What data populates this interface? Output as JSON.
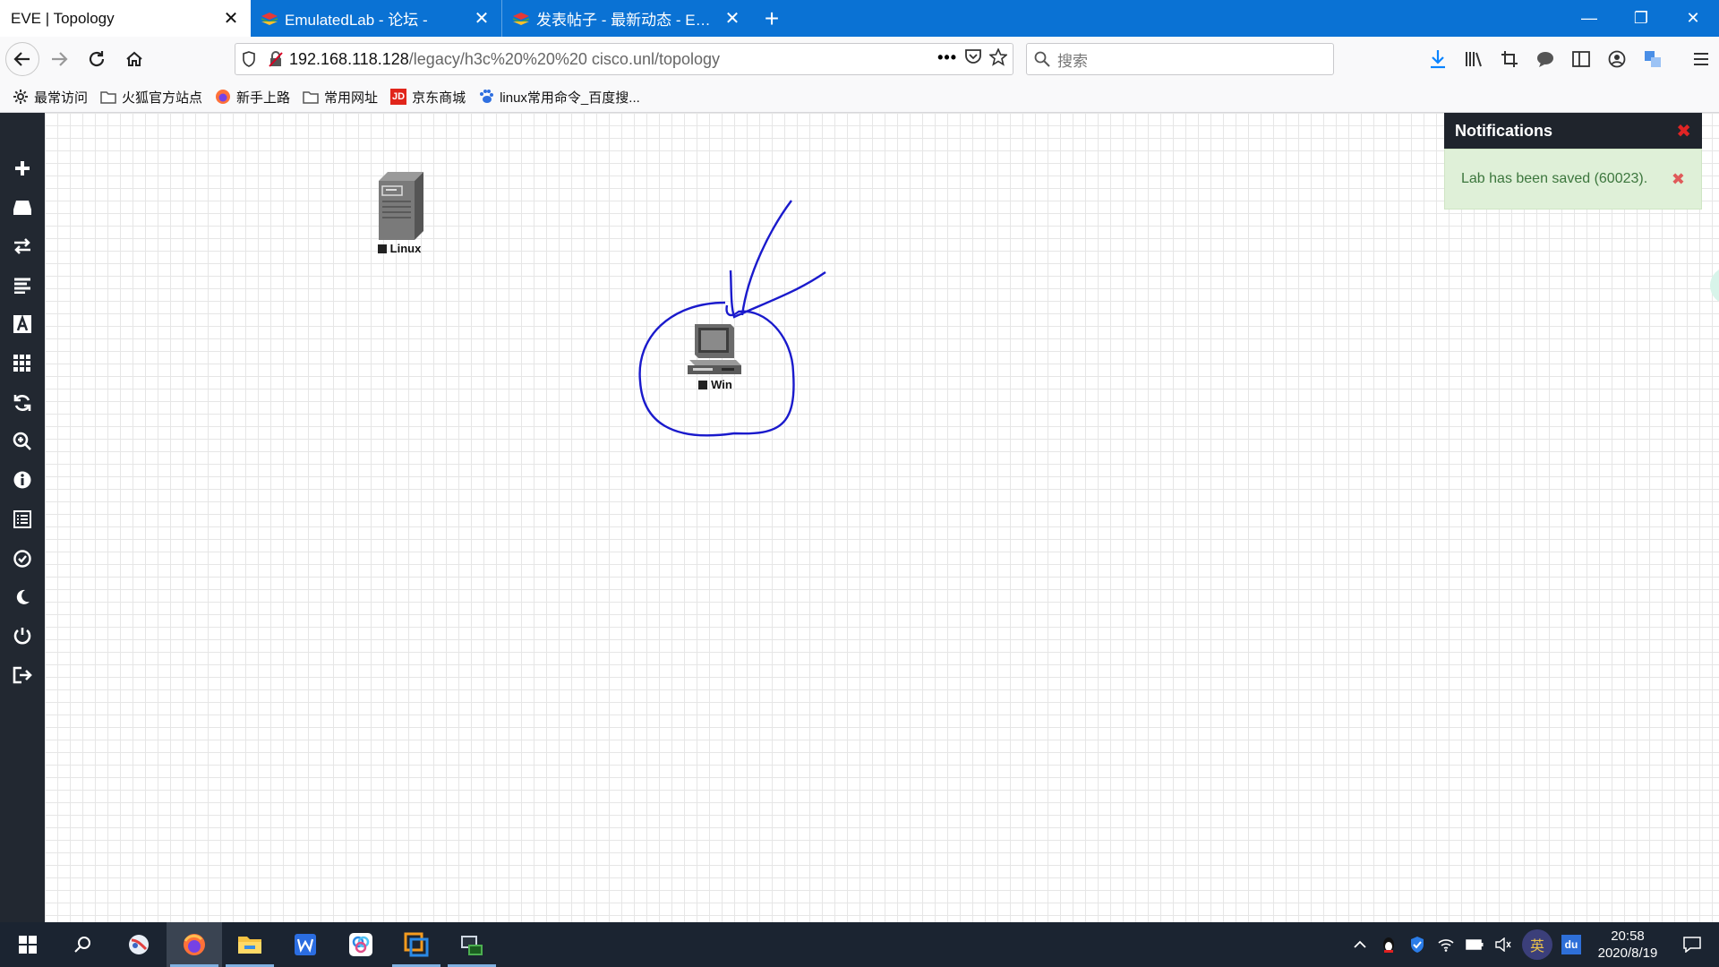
{
  "tabs": [
    {
      "label": "EVE | Topology",
      "active": true
    },
    {
      "label": "EmulatedLab - 论坛 -",
      "active": false
    },
    {
      "label": "发表帖子 - 最新动态 - Emulat",
      "active": false
    }
  ],
  "address": {
    "host": "192.168.118.128",
    "path": "/legacy/h3c%20%20%20 cisco.unl/topology"
  },
  "search": {
    "placeholder": "搜索"
  },
  "bookmarks": [
    {
      "label": "最常访问",
      "icon": "gear-icon"
    },
    {
      "label": "火狐官方站点",
      "icon": "folder-icon"
    },
    {
      "label": "新手上路",
      "icon": "firefox-icon"
    },
    {
      "label": "常用网址",
      "icon": "folder-icon"
    },
    {
      "label": "京东商城",
      "icon": "jd-icon"
    },
    {
      "label": "linux常用命令_百度搜...",
      "icon": "baidu-paw-icon"
    }
  ],
  "sidebar_icons": [
    "plus-icon",
    "node-icon",
    "network-icon",
    "list-icon",
    "text-icon",
    "grid-icon",
    "refresh-icon",
    "zoom-icon",
    "info-icon",
    "logs-icon",
    "check-icon",
    "moon-icon",
    "power-icon",
    "logout-icon"
  ],
  "nodes": [
    {
      "name": "Linux",
      "type": "server"
    },
    {
      "name": "Win",
      "type": "desktop"
    }
  ],
  "notifications": {
    "title": "Notifications",
    "message": "Lab has been saved (60023)."
  },
  "taskbar": {
    "time": "20:58",
    "date": "2020/8/19",
    "ime": "英"
  },
  "colors": {
    "tabbar": "#0a72d4",
    "sidebar": "#222831",
    "annotation": "#1a1acc",
    "notif_success": "#dff0d8"
  }
}
